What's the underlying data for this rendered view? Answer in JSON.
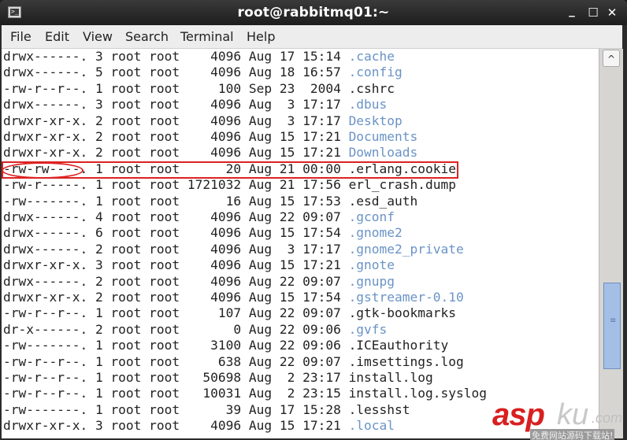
{
  "window": {
    "title": "root@rabbitmq01:~",
    "icon": "terminal-icon",
    "controls": {
      "minimize": "_",
      "maximize": "☐",
      "close": "✕"
    }
  },
  "menu": [
    "File",
    "Edit",
    "View",
    "Search",
    "Terminal",
    "Help"
  ],
  "colors": {
    "directory": "#6a93c6",
    "highlight": "#dd2222",
    "text": "#222222"
  },
  "listing": [
    {
      "perm": "drwx------.",
      "links": "3",
      "owner": "root",
      "group": "root",
      "size": "4096",
      "month": "Aug",
      "day": "17",
      "time": "15:14",
      "name": ".cache",
      "dir": true
    },
    {
      "perm": "drwx------.",
      "links": "5",
      "owner": "root",
      "group": "root",
      "size": "4096",
      "month": "Aug",
      "day": "18",
      "time": "16:57",
      "name": ".config",
      "dir": true
    },
    {
      "perm": "-rw-r--r--.",
      "links": "1",
      "owner": "root",
      "group": "root",
      "size": "100",
      "month": "Sep",
      "day": "23",
      "time": "2004",
      "name": ".cshrc",
      "dir": false
    },
    {
      "perm": "drwx------.",
      "links": "3",
      "owner": "root",
      "group": "root",
      "size": "4096",
      "month": "Aug",
      "day": "3",
      "time": "17:17",
      "name": ".dbus",
      "dir": true
    },
    {
      "perm": "drwxr-xr-x.",
      "links": "2",
      "owner": "root",
      "group": "root",
      "size": "4096",
      "month": "Aug",
      "day": "3",
      "time": "17:17",
      "name": "Desktop",
      "dir": true
    },
    {
      "perm": "drwxr-xr-x.",
      "links": "2",
      "owner": "root",
      "group": "root",
      "size": "4096",
      "month": "Aug",
      "day": "15",
      "time": "17:21",
      "name": "Documents",
      "dir": true
    },
    {
      "perm": "drwxr-xr-x.",
      "links": "2",
      "owner": "root",
      "group": "root",
      "size": "4096",
      "month": "Aug",
      "day": "15",
      "time": "17:21",
      "name": "Downloads",
      "dir": true
    },
    {
      "perm": "-rw-rw----.",
      "links": "1",
      "owner": "root",
      "group": "root",
      "size": "20",
      "month": "Aug",
      "day": "21",
      "time": "00:00",
      "name": ".erlang.cookie",
      "dir": false,
      "highlighted": true
    },
    {
      "perm": "-rw-r-----.",
      "links": "1",
      "owner": "root",
      "group": "root",
      "size": "1721032",
      "month": "Aug",
      "day": "21",
      "time": "17:56",
      "name": "erl_crash.dump",
      "dir": false
    },
    {
      "perm": "-rw-------.",
      "links": "1",
      "owner": "root",
      "group": "root",
      "size": "16",
      "month": "Aug",
      "day": "15",
      "time": "17:53",
      "name": ".esd_auth",
      "dir": false
    },
    {
      "perm": "drwx------.",
      "links": "4",
      "owner": "root",
      "group": "root",
      "size": "4096",
      "month": "Aug",
      "day": "22",
      "time": "09:07",
      "name": ".gconf",
      "dir": true
    },
    {
      "perm": "drwx------.",
      "links": "6",
      "owner": "root",
      "group": "root",
      "size": "4096",
      "month": "Aug",
      "day": "15",
      "time": "17:54",
      "name": ".gnome2",
      "dir": true
    },
    {
      "perm": "drwx------.",
      "links": "2",
      "owner": "root",
      "group": "root",
      "size": "4096",
      "month": "Aug",
      "day": "3",
      "time": "17:17",
      "name": ".gnome2_private",
      "dir": true
    },
    {
      "perm": "drwxr-xr-x.",
      "links": "3",
      "owner": "root",
      "group": "root",
      "size": "4096",
      "month": "Aug",
      "day": "15",
      "time": "17:21",
      "name": ".gnote",
      "dir": true
    },
    {
      "perm": "drwx------.",
      "links": "2",
      "owner": "root",
      "group": "root",
      "size": "4096",
      "month": "Aug",
      "day": "22",
      "time": "09:07",
      "name": ".gnupg",
      "dir": true
    },
    {
      "perm": "drwxr-xr-x.",
      "links": "2",
      "owner": "root",
      "group": "root",
      "size": "4096",
      "month": "Aug",
      "day": "15",
      "time": "17:54",
      "name": ".gstreamer-0.10",
      "dir": true
    },
    {
      "perm": "-rw-r--r--.",
      "links": "1",
      "owner": "root",
      "group": "root",
      "size": "107",
      "month": "Aug",
      "day": "22",
      "time": "09:07",
      "name": ".gtk-bookmarks",
      "dir": false
    },
    {
      "perm": "dr-x------.",
      "links": "2",
      "owner": "root",
      "group": "root",
      "size": "0",
      "month": "Aug",
      "day": "22",
      "time": "09:06",
      "name": ".gvfs",
      "dir": true
    },
    {
      "perm": "-rw-------.",
      "links": "1",
      "owner": "root",
      "group": "root",
      "size": "3100",
      "month": "Aug",
      "day": "22",
      "time": "09:06",
      "name": ".ICEauthority",
      "dir": false
    },
    {
      "perm": "-rw-r--r--.",
      "links": "1",
      "owner": "root",
      "group": "root",
      "size": "638",
      "month": "Aug",
      "day": "22",
      "time": "09:07",
      "name": ".imsettings.log",
      "dir": false
    },
    {
      "perm": "-rw-r--r--.",
      "links": "1",
      "owner": "root",
      "group": "root",
      "size": "50698",
      "month": "Aug",
      "day": "2",
      "time": "23:17",
      "name": "install.log",
      "dir": false
    },
    {
      "perm": "-rw-r--r--.",
      "links": "1",
      "owner": "root",
      "group": "root",
      "size": "10031",
      "month": "Aug",
      "day": "2",
      "time": "23:15",
      "name": "install.log.syslog",
      "dir": false
    },
    {
      "perm": "-rw-------.",
      "links": "1",
      "owner": "root",
      "group": "root",
      "size": "39",
      "month": "Aug",
      "day": "17",
      "time": "15:28",
      "name": ".lesshst",
      "dir": false
    },
    {
      "perm": "drwxr-xr-x.",
      "links": "3",
      "owner": "root",
      "group": "root",
      "size": "4096",
      "month": "Aug",
      "day": "15",
      "time": "17:21",
      "name": ".local",
      "dir": true
    }
  ],
  "scrollbar": {
    "up_arrow": "^",
    "grip": "≡",
    "position_fraction": 0.62
  },
  "watermark": {
    "brand_a": "asp",
    "brand_b": "ku",
    "suffix": ".com",
    "tagline": "免费网站源码下载站!"
  }
}
